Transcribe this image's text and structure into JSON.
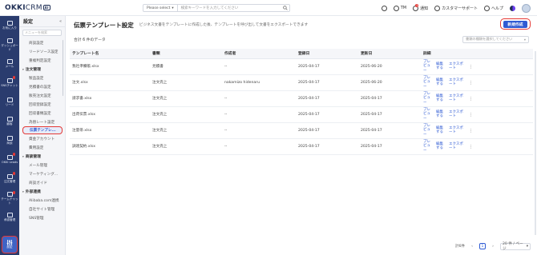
{
  "app": {
    "logo": "OKKI",
    "logo_crm": "CRM",
    "logo_badge": "AI"
  },
  "topbar": {
    "search_select": "Please select",
    "search_placeholder": "検索キーワードを入力してください",
    "tm_label": "TM",
    "notify_label": "通知",
    "notify_badge": "1",
    "support_label": "カスタマーサポート",
    "help_label": "ヘルプ"
  },
  "rail": {
    "items": [
      {
        "label": "お気に入り",
        "icon": "star-icon"
      },
      {
        "label": "ダッシュボード",
        "icon": "dashboard-icon"
      },
      {
        "label": "メール",
        "icon": "mail-icon"
      },
      {
        "label": "SNSチャット",
        "icon": "chat-icon"
      },
      {
        "label": "リード",
        "icon": "lead-icon"
      },
      {
        "label": "顧客",
        "icon": "customer-icon"
      },
      {
        "label": "商談",
        "icon": "deal-icon"
      },
      {
        "label": "OKKI Leads",
        "icon": "leads-icon"
      },
      {
        "label": "注文管理",
        "icon": "order-icon"
      },
      {
        "label": "チームチャット",
        "icon": "team-chat-icon"
      },
      {
        "label": "承認管理",
        "icon": "approval-icon"
      }
    ],
    "active_label": "設定"
  },
  "sidebar": {
    "title": "設定",
    "collapse": "«",
    "search_placeholder": "メニューを検索",
    "items_top": [
      "商談設定",
      "リードソース設定",
      "重複判定設定"
    ],
    "group1": "注文管理",
    "group1_items": [
      "製品設定",
      "見積書の設定",
      "販売注文設定",
      "回収登録設定",
      "回収書類設定",
      "為替レート設定",
      "伝票テンプレ...",
      "資金アカウント",
      "費用設定"
    ],
    "active_index": 6,
    "group2": "商談管理",
    "group2_items": [
      "メール管理",
      "マーケティング...",
      "商談ガイド"
    ],
    "group3": "外部連携",
    "group3_items": [
      "Alibaba.com連携",
      "自社サイト管理",
      "SNS管理"
    ]
  },
  "main": {
    "title": "伝票テンプレート設定",
    "description": "ビジネス文書をテンプレートに作成した後、テンプレートを呼び出して文書をエクスポートできます",
    "new_button": "新規作成",
    "count_text": "合計 6 件のデータ",
    "filter_placeholder": "書類の種類を選択してください",
    "columns": [
      "テンプレート名",
      "書類",
      "作成者",
      "登録日",
      "更新日",
      "詳細"
    ],
    "rows": [
      {
        "name": "我社準備帳.xlsx",
        "doc": "見積書",
        "creator": "--",
        "created": "2025-04-17",
        "updated": "2025-06-20"
      },
      {
        "name": "注文.xlsx",
        "doc": "注文売上",
        "creator": "nakamizo hidenaru",
        "created": "2025-04-17",
        "updated": "2025-06-20"
      },
      {
        "name": "請求書.xlsx",
        "doc": "注文売上",
        "creator": "--",
        "created": "2025-04-17",
        "updated": "2025-04-17"
      },
      {
        "name": "出荷伝票.xlsx",
        "doc": "注文売上",
        "creator": "--",
        "created": "2025-04-17",
        "updated": "2025-04-17"
      },
      {
        "name": "注量帯.xlsx",
        "doc": "注文売上",
        "creator": "--",
        "created": "2025-04-17",
        "updated": "2025-04-17"
      },
      {
        "name": "調達契約.xlsx",
        "doc": "注文売上",
        "creator": "--",
        "created": "2025-04-17",
        "updated": "2025-04-17"
      }
    ],
    "actions": {
      "preview": "プレビュー",
      "edit": "編集する",
      "export": "エクスポート",
      "more": "⋮"
    },
    "pager": {
      "total": "計6件",
      "prev": "‹",
      "page": "1",
      "next": "›",
      "size": "20 件 / ページ"
    }
  },
  "colors": {
    "accent": "#2f5bd3",
    "rail": "#2a3c6e",
    "highlight": "#e53935"
  }
}
